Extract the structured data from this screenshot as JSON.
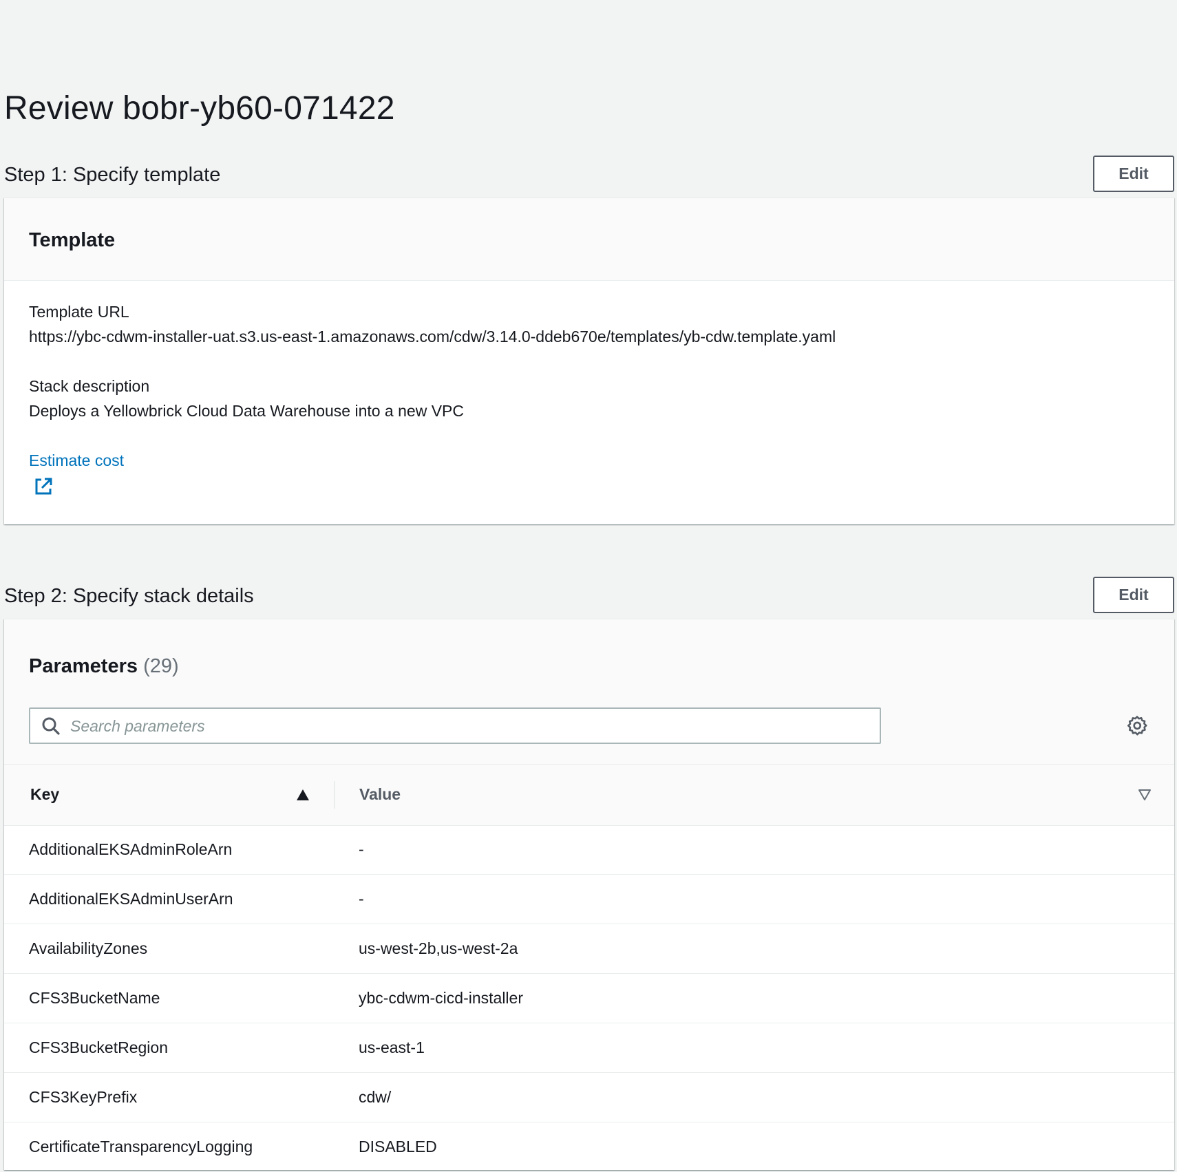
{
  "page": {
    "title": "Review bobr-yb60-071422"
  },
  "step1": {
    "title": "Step 1: Specify template",
    "edit_label": "Edit",
    "panel_title": "Template",
    "template_url_label": "Template URL",
    "template_url_value": "https://ybc-cdwm-installer-uat.s3.us-east-1.amazonaws.com/cdw/3.14.0-ddeb670e/templates/yb-cdw.template.yaml",
    "stack_description_label": "Stack description",
    "stack_description_value": "Deploys a Yellowbrick Cloud Data Warehouse into a new VPC",
    "estimate_cost_label": "Estimate cost",
    "estimate_cost_icon": "external-link-icon"
  },
  "step2": {
    "title": "Step 2: Specify stack details",
    "edit_label": "Edit",
    "panel_title": "Parameters",
    "panel_count": "(29)",
    "search": {
      "placeholder": "Search parameters",
      "value": ""
    },
    "table": {
      "columns": {
        "key": "Key",
        "value": "Value"
      },
      "rows": [
        {
          "key": "AdditionalEKSAdminRoleArn",
          "value": "-"
        },
        {
          "key": "AdditionalEKSAdminUserArn",
          "value": "-"
        },
        {
          "key": "AvailabilityZones",
          "value": "us-west-2b,us-west-2a"
        },
        {
          "key": "CFS3BucketName",
          "value": "ybc-cdwm-cicd-installer"
        },
        {
          "key": "CFS3BucketRegion",
          "value": "us-east-1"
        },
        {
          "key": "CFS3KeyPrefix",
          "value": "cdw/"
        },
        {
          "key": "CertificateTransparencyLogging",
          "value": "DISABLED"
        }
      ]
    }
  },
  "colors": {
    "background": "#f2f3f3",
    "panel": "#ffffff",
    "panel_header": "#fafafa",
    "link": "#0073bb",
    "text": "#16191f",
    "muted_text": "#687078",
    "button_border": "#545b64"
  }
}
